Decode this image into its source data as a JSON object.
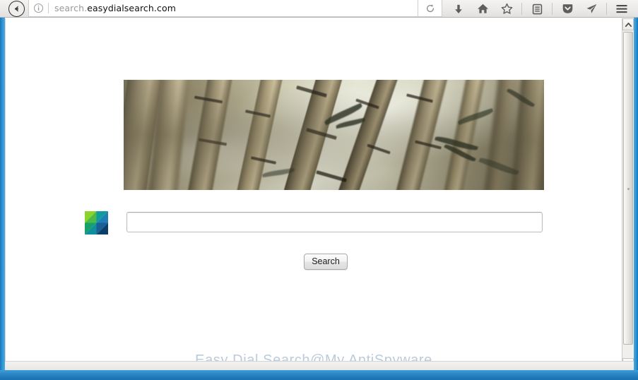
{
  "browser": {
    "url_display": "search.easydialsearch.com",
    "url_scheme_part": "search.",
    "url_domain_part": "easydialsearch.com",
    "back_label": "Back",
    "info_label": "Site information",
    "reload_label": "Reload",
    "toolbar_icons": [
      {
        "name": "downloads-icon",
        "label": "Downloads"
      },
      {
        "name": "home-icon",
        "label": "Home"
      },
      {
        "name": "bookmark-star-icon",
        "label": "Bookmark this page"
      },
      {
        "name": "library-icon",
        "label": "Library"
      },
      {
        "name": "pocket-icon",
        "label": "Save to Pocket"
      },
      {
        "name": "send-tab-icon",
        "label": "Send tab"
      },
      {
        "name": "hamburger-menu-icon",
        "label": "Open menu"
      }
    ]
  },
  "page": {
    "banner_alt": "Bamboo stalks photograph banner",
    "logo_name": "easy-dial-search-logo",
    "logo_colors": {
      "light_green": "#7ed321",
      "green": "#32b44a",
      "teal_light": "#13a89e",
      "teal": "#0e8f9e",
      "blue_mid": "#1a6fa8",
      "blue_dark": "#0d4f7c",
      "blue_deep": "#0a3f66"
    },
    "search_input_value": "",
    "search_input_placeholder": "",
    "search_button_label": "Search",
    "watermark_text": "Easy Dial Search@My AntiSpyware"
  },
  "scrollbar": {
    "up_arrow_label": "Scroll up",
    "down_arrow_label": "Scroll down",
    "thumb_label": "Scroll thumb"
  }
}
